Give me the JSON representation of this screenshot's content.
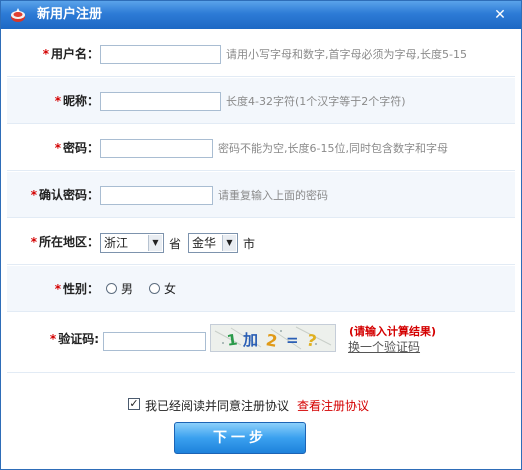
{
  "window": {
    "title": "新用户注册",
    "close_label": "✕"
  },
  "form": {
    "username": {
      "label": "用户名：",
      "value": "",
      "hint": "请用小写字母和数字,首字母必须为字母,长度5-15"
    },
    "nickname": {
      "label": "昵称：",
      "value": "",
      "hint": "长度4-32字符(1个汉字等于2个字符)"
    },
    "password": {
      "label": "密码：",
      "value": "",
      "hint": "密码不能为空,长度6-15位,同时包含数字和字母"
    },
    "confirm_password": {
      "label": "确认密码：",
      "value": "",
      "hint": "请重复输入上面的密码"
    },
    "region": {
      "label": "所在地区：",
      "province": "浙江",
      "province_unit": "省",
      "city": "金华",
      "city_unit": "市"
    },
    "gender": {
      "label": "性别：",
      "options": [
        "男",
        "女"
      ]
    },
    "captcha": {
      "label": "验证码:",
      "value": "",
      "image_text": "1 加 2 = ?",
      "hint": "(请输入计算结果)",
      "refresh_link": "换一个验证码"
    },
    "agreement": {
      "checked": true,
      "text": "我已经阅读并同意注册协议",
      "link": "查看注册协议"
    },
    "next_button": "下一步"
  },
  "colors": {
    "titlebar": "#2d7bd6",
    "required": "#d40000",
    "hint": "#8a8a8a"
  }
}
